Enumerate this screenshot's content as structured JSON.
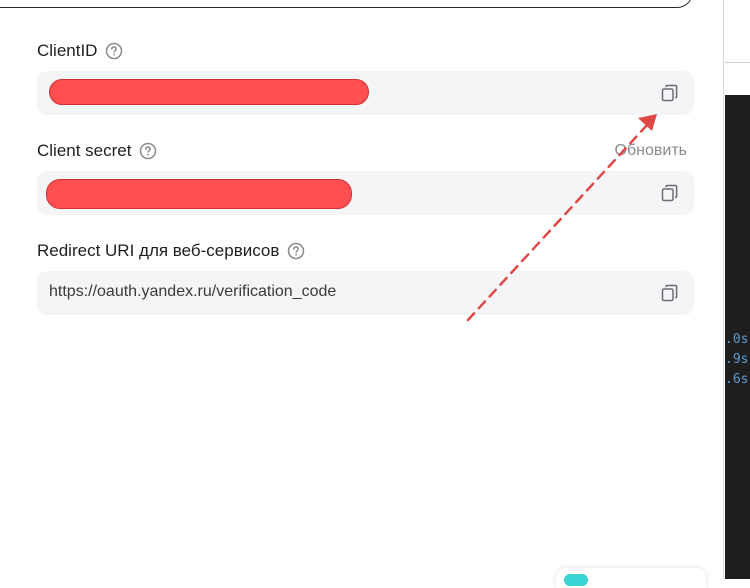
{
  "fields": {
    "client_id": {
      "label": "ClientID"
    },
    "client_secret": {
      "label": "Client secret",
      "refresh_label": "Обновить"
    },
    "redirect_uri": {
      "label": "Redirect URI для веб-сервисов",
      "value": "https://oauth.yandex.ru/verification_code"
    }
  },
  "terminal": {
    "lines": [
      ".0s",
      ".9s",
      ".6s"
    ]
  },
  "colors": {
    "mask": "#ff4f51",
    "arrow": "#e04848",
    "field_bg": "#f5f5f7"
  },
  "icons": {
    "help": "help-icon",
    "copy": "copy-icon"
  }
}
